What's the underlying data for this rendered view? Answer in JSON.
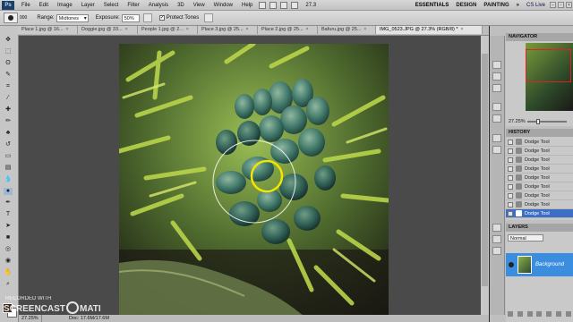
{
  "app": {
    "logo": "Ps"
  },
  "menu": [
    "File",
    "Edit",
    "Image",
    "Layer",
    "Select",
    "Filter",
    "Analysis",
    "3D",
    "View",
    "Window",
    "Help"
  ],
  "menubar": {
    "zoom_readout": "27.3",
    "workspaces": [
      "ESSENTIALS",
      "DESIGN",
      "PAINTING"
    ],
    "more": "»",
    "cs_live": "CS Live"
  },
  "options": {
    "brush_size": "900",
    "range_label": "Range:",
    "range_value": "Midtones",
    "exposure_label": "Exposure:",
    "exposure_value": "50%",
    "protect_tones_label": "Protect Tones",
    "protect_tones_check": "✓"
  },
  "tabs": [
    {
      "label": "Place 1.jpg @ 16..."
    },
    {
      "label": "Doggie.jpg @ 33..."
    },
    {
      "label": "People 1.jpg @ 2..."
    },
    {
      "label": "Place 3.jpg @ 25..."
    },
    {
      "label": "Place 2.jpg @ 25..."
    },
    {
      "label": "Bafuru.jpg @ 25..."
    },
    {
      "label": "IMG_0523.JPG @ 27.3% (RGB/8) *"
    }
  ],
  "status": {
    "zoom": "27.25%",
    "doc": "Doc: 17.6M/17.6M"
  },
  "navigator": {
    "title": "NAVIGATOR",
    "zoom": "27.25%"
  },
  "history": {
    "title": "HISTORY",
    "items": [
      "Dodge Tool",
      "Dodge Tool",
      "Dodge Tool",
      "Dodge Tool",
      "Dodge Tool",
      "Dodge Tool",
      "Dodge Tool",
      "Dodge Tool",
      "Dodge Tool"
    ]
  },
  "layers": {
    "title": "LAYERS",
    "blend": "Normal",
    "layer_name": "Background"
  },
  "watermark": {
    "line1": "RECORDED WITH",
    "line2": "SCREENCAST",
    "line3": "MATIC"
  },
  "colors": {
    "selection_blue": "#3b6fc6",
    "layer_blue": "#3b8de0",
    "brush_cursor": "#f2e600"
  }
}
